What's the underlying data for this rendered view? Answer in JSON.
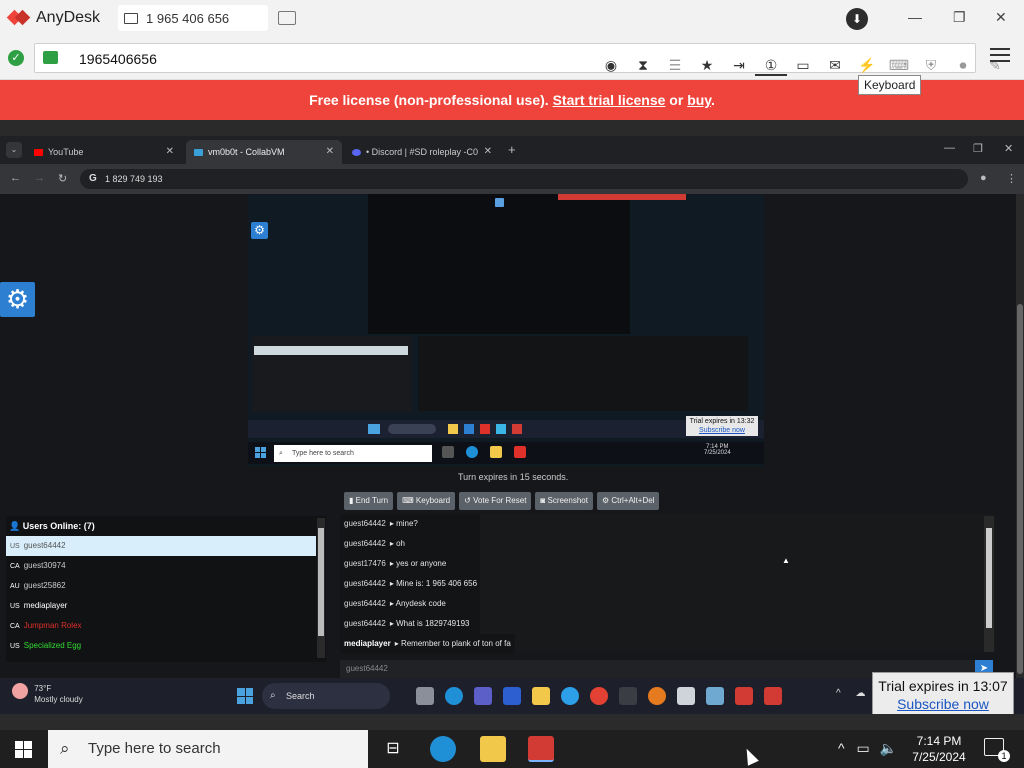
{
  "anydesk": {
    "app_name": "AnyDesk",
    "tab_label": "1 965 406 656",
    "address_value": "1965406656",
    "tooltip": "Keyboard",
    "license_banner": {
      "prefix": "Free license (non-professional use). ",
      "trial_link": "Start trial license",
      "middle": " or ",
      "buy_link": "buy",
      "suffix": "."
    },
    "toolbar_icons": [
      "view-icon",
      "hourglass-icon",
      "database-icon",
      "star-icon",
      "transfer-icon",
      "monitor-number-icon",
      "display-icon",
      "chat-icon",
      "lightning-icon",
      "keyboard-icon",
      "shield-icon",
      "record-icon",
      "pen-icon"
    ],
    "accent": "#ef443b"
  },
  "remote_chrome": {
    "tabs": [
      {
        "label": "YouTube",
        "color": "#ff0000"
      },
      {
        "label": "vm0b0t - CollabVM",
        "color": "#3aa0d8"
      },
      {
        "label": "• Discord | #SD roleplay -C0",
        "color": "#5865f2"
      }
    ],
    "url": "1 829 749 193"
  },
  "collabvm": {
    "turn_text": "Turn expires in 15 seconds.",
    "buttons": [
      "End Turn",
      "Keyboard",
      "Vote For Reset",
      "Screenshot",
      "Ctrl+Alt+Del"
    ],
    "users_title": "Users Online: (7)",
    "users": [
      {
        "cc": "US",
        "name": "guest64442",
        "color": "#555555"
      },
      {
        "cc": "CA",
        "name": "guest30974",
        "color": "#cccccc"
      },
      {
        "cc": "AU",
        "name": "guest25862",
        "color": "#cccccc"
      },
      {
        "cc": "US",
        "name": "mediaplayer",
        "color": "#ffffff"
      },
      {
        "cc": "CA",
        "name": "Jumpman Rolex",
        "color": "#e0302a"
      },
      {
        "cc": "US",
        "name": "Specialized Egg",
        "color": "#33dd33"
      }
    ],
    "chat": [
      {
        "user": "guest64442",
        "msg": "mine?"
      },
      {
        "user": "guest64442",
        "msg": "oh"
      },
      {
        "user": "guest17476",
        "msg": "yes or anyone"
      },
      {
        "user": "guest64442",
        "msg": "Mine is: 1 965 406 656"
      },
      {
        "user": "guest64442",
        "msg": "Anydesk code"
      },
      {
        "user": "guest64442",
        "msg": "What is 1829749193"
      },
      {
        "user": "mediaplayer",
        "msg": "Remember to plank of ton of fa"
      }
    ],
    "input_placeholder": "guest64442",
    "vm": {
      "search": "Type here to search",
      "time": "7:14 PM",
      "date": "7/25/2024",
      "trial_line": "Trial expires in 13:32",
      "trial_link": "Subscribe now"
    }
  },
  "remote_taskbar": {
    "temp": "73°F",
    "condition": "Mostly cloudy",
    "search": "Search",
    "trial_line": "Trial expires in 13:07",
    "trial_link": "Subscribe now"
  },
  "local_taskbar": {
    "search": "Type here to search",
    "time": "7:14 PM",
    "date": "7/25/2024",
    "notifications": "1"
  }
}
